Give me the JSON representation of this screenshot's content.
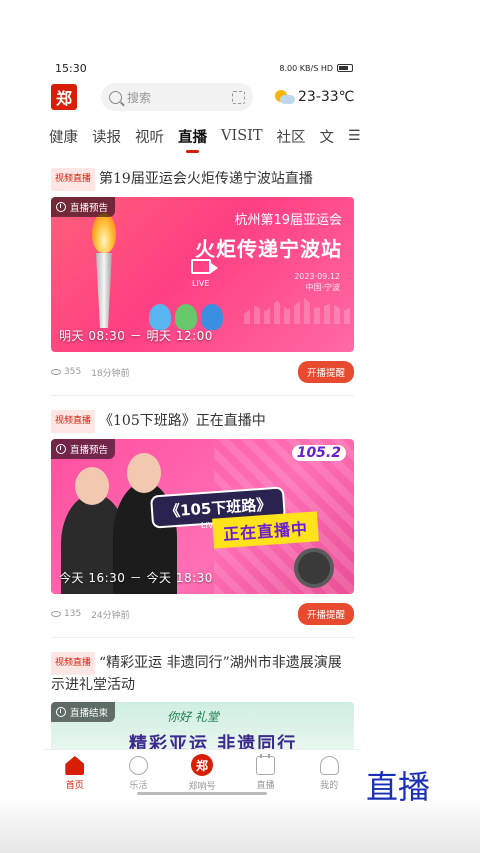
{
  "status_bar": {
    "time": "15:30",
    "indicators": "8.00 KB/S  HD"
  },
  "header": {
    "logo_text": "郑",
    "search_placeholder": "搜索",
    "weather_text": "23-33℃",
    "weather_icon": "partly-cloudy-icon"
  },
  "nav": {
    "tabs": [
      "健康",
      "读报",
      "视听",
      "直播",
      "VISIT",
      "社区",
      "文"
    ],
    "active_tab": "直播",
    "menu_icon": "☰"
  },
  "cards": [
    {
      "tag": "视频直播",
      "title": "第19届亚运会火炬传递宁波站直播",
      "badge": "直播预告",
      "banner_line1": "杭州第19届亚运会",
      "banner_line2": "火炬传递宁波站",
      "banner_live": "LIVE",
      "banner_date": "2023·09.12",
      "banner_place": "中国·宁波",
      "time_range": "明天 08:30 － 明天 12:00",
      "views": "355",
      "ago": "18分钟前",
      "button": "开播提醒"
    },
    {
      "tag": "视频直播",
      "title": "《105下班路》正在直播中",
      "badge": "直播预告",
      "banner_line1": "《105下班路》",
      "banner_line2": "正在直播中",
      "banner_live": "LIVE",
      "banner_logo": "105.2",
      "time_range": "今天 16:30 － 今天 18:30",
      "views": "135",
      "ago": "24分钟前",
      "button": "开播提醒"
    },
    {
      "tag": "视频直播",
      "title": "“精彩亚运 非遗同行”湖州市非遗展演展示进礼堂活动",
      "badge": "直播结束",
      "banner_line1": "你好 礼堂",
      "banner_line2": "精彩亚运 非遗同行"
    }
  ],
  "bottom_nav": {
    "items": [
      {
        "label": "首页",
        "icon": "home-icon",
        "active": true
      },
      {
        "label": "乐活",
        "icon": "chat-icon",
        "active": false
      },
      {
        "label": "郑响号",
        "icon": "zheng-logo-icon",
        "active": false
      },
      {
        "label": "直播",
        "icon": "calendar-icon",
        "active": false
      },
      {
        "label": "我的",
        "icon": "user-icon",
        "active": false
      }
    ],
    "center_glyph": "郑"
  },
  "overlay_label": "直播",
  "colors": {
    "brand_red": "#d81e06",
    "remind_button": "#e84a2f",
    "label_blue": "#1a2fb8"
  }
}
